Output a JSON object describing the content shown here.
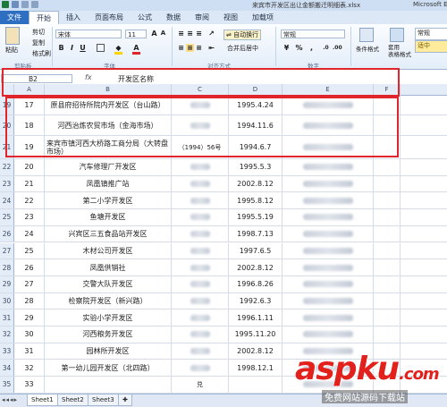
{
  "window": {
    "title": "来宾市开发区出让金额搬迁明细表.xlsx - Microsoft Excel",
    "title_short": "来宾市开发区出让金额搬迁明细表.xlsx",
    "app": "Microsoft E"
  },
  "tabs": [
    "文件",
    "开始",
    "插入",
    "页面布局",
    "公式",
    "数据",
    "审阅",
    "视图",
    "加载项"
  ],
  "ribbon": {
    "paste_label": "粘贴",
    "cut_label": "剪切",
    "copy_label": "复制",
    "format_painter_label": "格式刷",
    "clipboard_group": "剪贴板",
    "font_name": "宋体",
    "font_size": "11",
    "font_group": "字体",
    "wrap_text_label": "自动换行",
    "merge_label": "合并后居中",
    "alignment_group": "对齐方式",
    "number_format": "常规",
    "number_group": "数字",
    "conditional_label": "条件格式",
    "table_format_label": "套用\n表格格式",
    "style_normal": "常规",
    "style_medium": "适中"
  },
  "formula_bar": {
    "cell_ref": "B2",
    "fx": "fx",
    "content": "开发区名称"
  },
  "columns": [
    "A",
    "B",
    "C",
    "D",
    "E",
    "F"
  ],
  "rows": [
    {
      "row": "19",
      "a": "17",
      "b": "原县府招待所院内开发区（台山路）",
      "c": "",
      "d": "1995.4.24"
    },
    {
      "row": "20",
      "a": "18",
      "b": "河西治炼农贸市场（金海市场）",
      "c": "",
      "d": "1994.11.6"
    },
    {
      "row": "21",
      "a": "19",
      "b": "来宾市镇河西大桥路工商分局（大转盘市场）",
      "c": "（1994）56号",
      "d": "1994.6.7"
    },
    {
      "row": "22",
      "a": "20",
      "b": "汽车修理厂开发区",
      "c": "",
      "d": "1995.5.3"
    },
    {
      "row": "23",
      "a": "21",
      "b": "凤凰镇推广站",
      "c": "",
      "d": "2002.8.12"
    },
    {
      "row": "24",
      "a": "22",
      "b": "第二小学开发区",
      "c": "",
      "d": "1995.8.12"
    },
    {
      "row": "25",
      "a": "23",
      "b": "鱼塘开发区",
      "c": "",
      "d": "1995.5.19"
    },
    {
      "row": "26",
      "a": "24",
      "b": "兴宾区三五食品站开发区",
      "c": "",
      "d": "1998.7.13"
    },
    {
      "row": "27",
      "a": "25",
      "b": "木材公司开发区",
      "c": "",
      "d": "1997.6.5"
    },
    {
      "row": "28",
      "a": "26",
      "b": "凤凰供销社",
      "c": "",
      "d": "2002.8.12"
    },
    {
      "row": "29",
      "a": "27",
      "b": "交警大队开发区",
      "c": "",
      "d": "1996.8.26"
    },
    {
      "row": "30",
      "a": "28",
      "b": "检察院开发区（新兴路）",
      "c": "",
      "d": "1992.6.3"
    },
    {
      "row": "31",
      "a": "29",
      "b": "实验小学开发区",
      "c": "",
      "d": "1996.1.11"
    },
    {
      "row": "32",
      "a": "30",
      "b": "河西粮务开发区",
      "c": "",
      "d": "1995.11.20"
    },
    {
      "row": "33",
      "a": "31",
      "b": "园林所开发区",
      "c": "",
      "d": "2002.8.12"
    },
    {
      "row": "34",
      "a": "32",
      "b": "第一幼儿园开发区（北四路）",
      "c": "",
      "d": "1998.12.1"
    },
    {
      "row": "35",
      "a": "33",
      "b": "",
      "c": "兑",
      "d": ""
    }
  ],
  "sheets": [
    "Sheet1",
    "Sheet2",
    "Sheet3"
  ],
  "watermark": {
    "brand": "aspku",
    "brand_suffix": ".com",
    "tagline": "免费网站源码下载站"
  },
  "colors": {
    "file_tab": "#2f6fc2",
    "annotation_red": "#e0262c",
    "header_bg": "#e4ecf7"
  }
}
